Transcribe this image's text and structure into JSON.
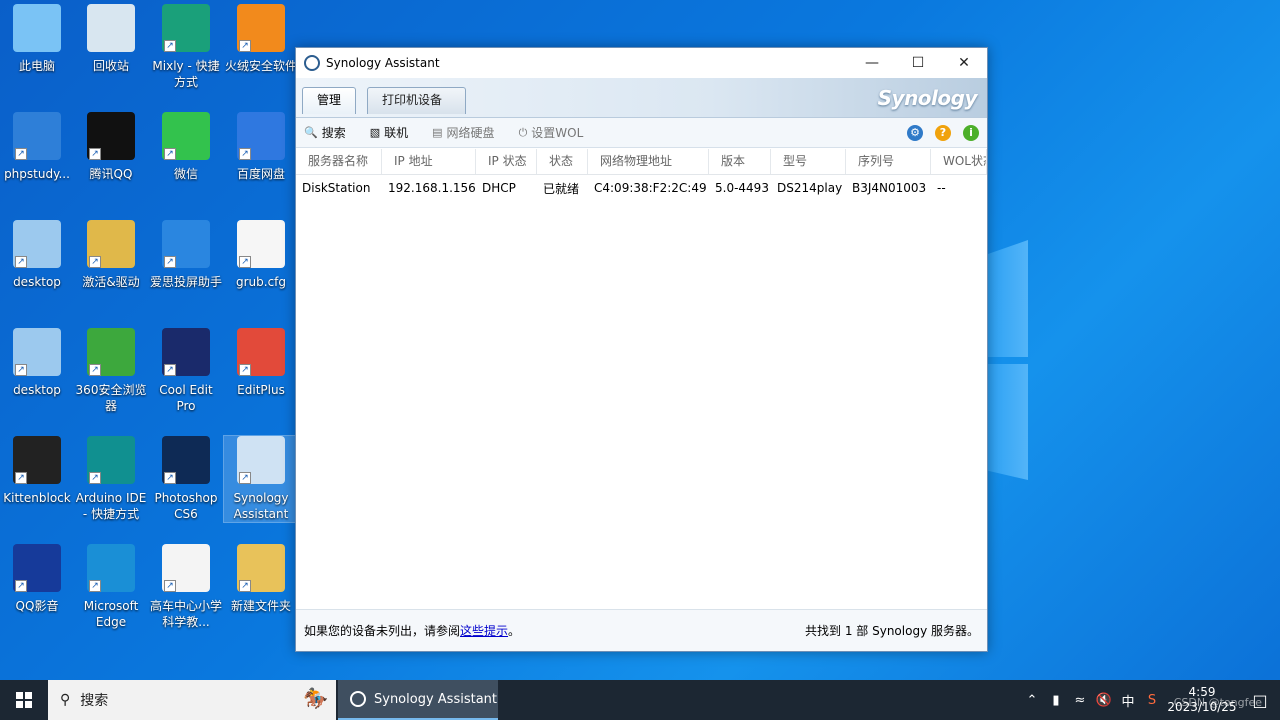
{
  "desktop": {
    "icons": [
      {
        "label": "此电脑",
        "icon": "computer-icon"
      },
      {
        "label": "回收站",
        "icon": "recycle-bin-icon"
      },
      {
        "label": "Mixly - 快捷方式",
        "icon": "mixly-icon"
      },
      {
        "label": "火绒安全软件",
        "icon": "huorong-icon"
      },
      {
        "label": "phpstudy...",
        "icon": "phpstudy-icon"
      },
      {
        "label": "腾讯QQ",
        "icon": "qq-icon"
      },
      {
        "label": "微信",
        "icon": "wechat-icon"
      },
      {
        "label": "百度网盘",
        "icon": "baidu-netdisk-icon"
      },
      {
        "label": "desktop",
        "icon": "file-icon"
      },
      {
        "label": "激活&驱动",
        "icon": "folder-icon"
      },
      {
        "label": "爱思投屏助手",
        "icon": "aisi-icon"
      },
      {
        "label": "grub.cfg",
        "icon": "file-icon"
      },
      {
        "label": "desktop",
        "icon": "file-icon"
      },
      {
        "label": "360安全浏览器",
        "icon": "360-browser-icon"
      },
      {
        "label": "Cool Edit Pro",
        "icon": "cooledit-icon"
      },
      {
        "label": "EditPlus",
        "icon": "editplus-icon"
      },
      {
        "label": "Kittenblock",
        "icon": "kittenblock-icon"
      },
      {
        "label": "Arduino IDE - 快捷方式",
        "icon": "arduino-icon"
      },
      {
        "label": "Photoshop CS6",
        "icon": "photoshop-icon"
      },
      {
        "label": "Synology Assistant",
        "icon": "synology-icon"
      },
      {
        "label": "QQ影音",
        "icon": "qq-player-icon"
      },
      {
        "label": "Microsoft Edge",
        "icon": "edge-icon"
      },
      {
        "label": "高车中心小学科学教...",
        "icon": "document-icon"
      },
      {
        "label": "新建文件夹",
        "icon": "folder-icon"
      }
    ]
  },
  "window": {
    "title": "Synology Assistant",
    "tabs": [
      "管理",
      "打印机设备"
    ],
    "brand": "Synology",
    "toolbar": {
      "search": "搜索",
      "connect": "联机",
      "network_drive": "网络硬盘",
      "wol": "设置WOL"
    },
    "columns": [
      "服务器名称",
      "IP 地址",
      "IP 状态",
      "状态",
      "网络物理地址",
      "版本",
      "型号",
      "序列号",
      "WOL状态"
    ],
    "rows": [
      [
        "DiskStation",
        "192.168.1.156",
        "DHCP",
        "已就绪",
        "C4:09:38:F2:2C:49",
        "5.0-4493",
        "DS214play",
        "B3J4N01003",
        "--"
      ]
    ],
    "footer": {
      "left_prefix": "如果您的设备未列出，请参阅",
      "link": "这些提示",
      "left_suffix": "。",
      "right": "共找到 1 部 Synology 服务器。"
    }
  },
  "taskbar": {
    "search_placeholder": "搜索",
    "app": "Synology Assistant",
    "ime": "中",
    "time": "4:59",
    "date": "2023/10/25",
    "watermark": "CSDN @tongfee"
  }
}
